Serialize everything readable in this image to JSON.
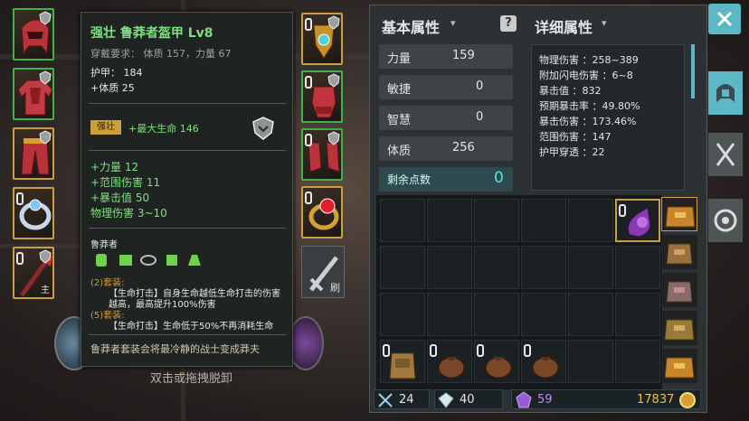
{
  "tooltip": {
    "title": "强壮 鲁莽者盔甲 Lv8",
    "requirement": "穿戴要求： 体质 157，力量 67",
    "base_stats": [
      "护甲： 184",
      "+体质 25"
    ],
    "enchant_badge": "强壮",
    "enchant_stat": "+最大生命 146",
    "affixes": [
      "+力量 12",
      "+范围伤害 11",
      "+暴击值 50",
      "物理伤害 3~10"
    ],
    "set_name": "鲁莽者",
    "set2_label": "(2)套装:",
    "set2_text_line1": "【生命打击】自身生命越低生命打击的伤害",
    "set2_text_line2": "越高，最高提升100%伤害",
    "set5_label": "(5)套装:",
    "set5_text": "【生命打击】生命低于50%不再消耗生命",
    "flavor": "鲁莽者套装会将最冷静的战士变成莽夫"
  },
  "hint": "双击或拖拽脱卸",
  "slot_labels": {
    "weapon": "主",
    "reforge": "刷"
  },
  "basic": {
    "header": "基本属性",
    "stats": [
      {
        "label": "力量",
        "value": "159"
      },
      {
        "label": "敏捷",
        "value": "0"
      },
      {
        "label": "智慧",
        "value": "0"
      },
      {
        "label": "体质",
        "value": "256"
      }
    ],
    "remaining_label": "剩余点数",
    "remaining_value": "0"
  },
  "detail": {
    "header": "详细属性",
    "lines": [
      "物理伤害 ：258~389",
      "附加闪电伤害 ：6~8",
      "暴击值 ：832",
      "预期暴击率 ：49.80%",
      "暴击伤害 ：173.46%",
      "范围伤害 ：147",
      "护甲穿透 ：22"
    ]
  },
  "currency": {
    "swords": "24",
    "gems": "40",
    "crystals": "59",
    "gold": "17837"
  },
  "colors": {
    "accent": "#5bb8c4",
    "legendary": "#c8a040",
    "rare": "#3fb34a",
    "affix": "#7ee07e",
    "enchant_badge": "#c9a13a"
  },
  "icons": [
    "close-icon",
    "helmet-tab-icon",
    "swords-tab-icon",
    "gear-tab-icon",
    "help-icon",
    "sword-icon"
  ]
}
